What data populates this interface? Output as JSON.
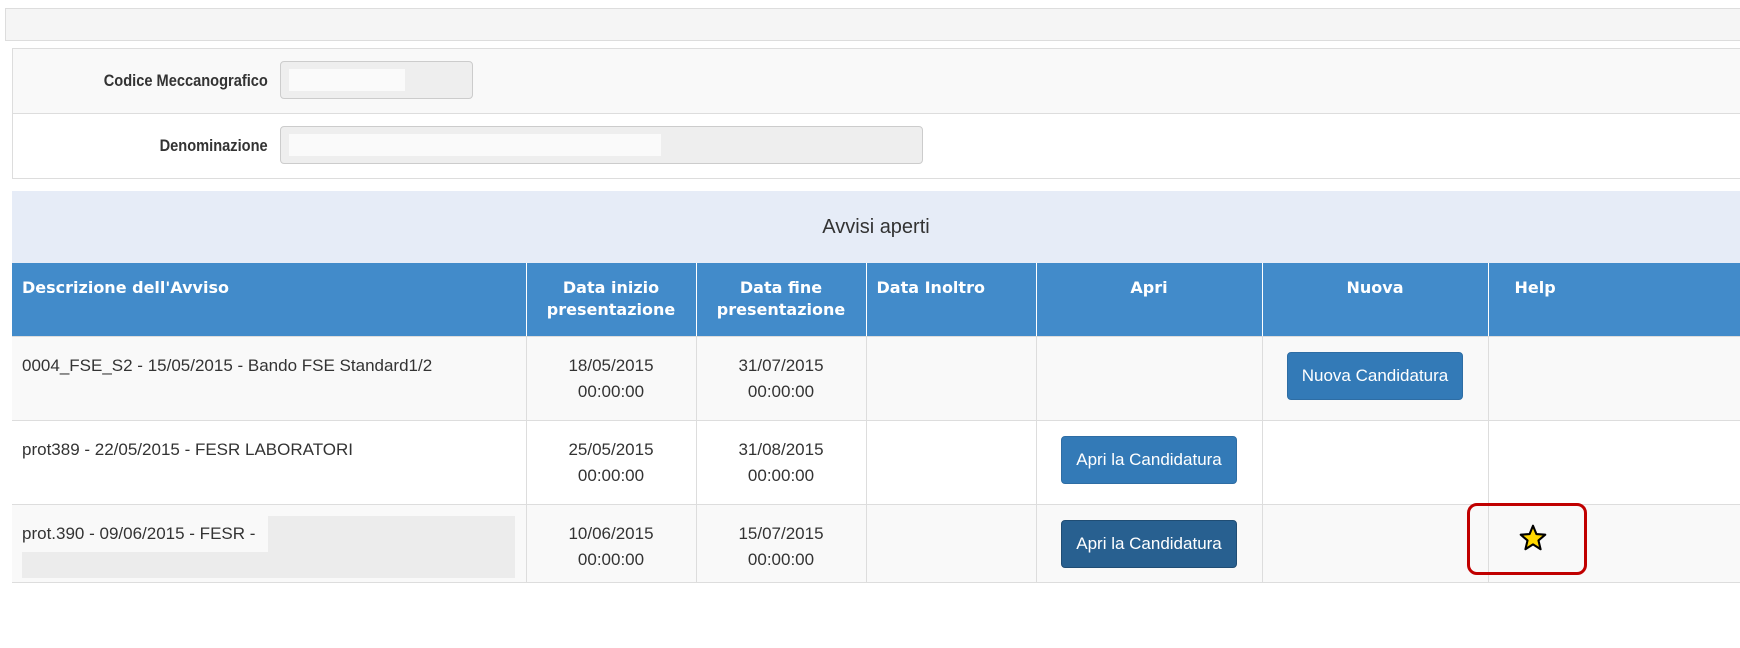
{
  "form": {
    "codice_label": "Codice Meccanografico",
    "codice_value": "",
    "denominazione_label": "Denominazione",
    "denominazione_value": ""
  },
  "section": {
    "title": "Avvisi aperti"
  },
  "table": {
    "headers": {
      "descrizione": "Descrizione dell'Avviso",
      "data_inizio_1": "Data inizio",
      "data_inizio_2": "presentazione",
      "data_fine_1": "Data fine",
      "data_fine_2": "presentazione",
      "data_inoltro": "Data Inoltro",
      "apri": "Apri",
      "nuova": "Nuova",
      "help": "Help"
    },
    "rows": [
      {
        "descrizione": "0004_FSE_S2 - 15/05/2015 - Bando FSE Standard1/2",
        "inizio_date": "18/05/2015",
        "inizio_time": "00:00:00",
        "fine_date": "31/07/2015",
        "fine_time": "00:00:00",
        "inoltro": "",
        "nuova_button": "Nuova Candidatura"
      },
      {
        "descrizione": "prot389 - 22/05/2015 - FESR LABORATORI",
        "inizio_date": "25/05/2015",
        "inizio_time": "00:00:00",
        "fine_date": "31/08/2015",
        "fine_time": "00:00:00",
        "inoltro": "",
        "apri_button": "Apri la Candidatura"
      },
      {
        "descrizione": "prot.390 - 09/06/2015 - FESR -",
        "inizio_date": "10/06/2015",
        "inizio_time": "00:00:00",
        "fine_date": "15/07/2015",
        "fine_time": "00:00:00",
        "inoltro": "",
        "apri_button": "Apri la Candidatura",
        "help_icon": "star-icon"
      }
    ]
  },
  "colors": {
    "header_bg": "#428bca",
    "section_bg": "#e6ecf7",
    "button_bg": "#337ab7",
    "highlight": "#c00000",
    "star_fill": "#ffd700"
  }
}
